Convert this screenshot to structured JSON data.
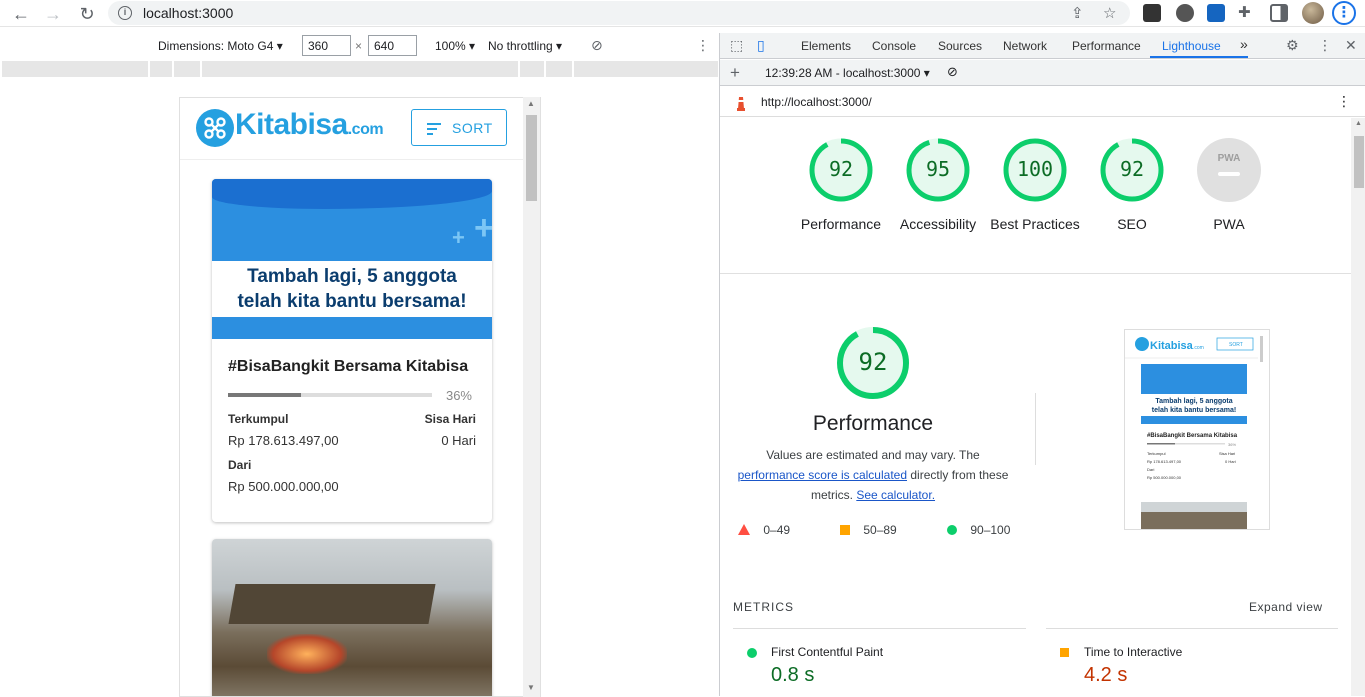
{
  "browser": {
    "url": "localhost:3000"
  },
  "device_toolbar": {
    "dimensions_label": "Dimensions: Moto G4",
    "width": "360",
    "height": "640",
    "times": "×",
    "zoom": "100%",
    "throttling": "No throttling"
  },
  "app": {
    "brand": "Kitabisa",
    "brand_suffix": ".com",
    "sort_label": "SORT",
    "card": {
      "banner_line1": "Tambah lagi, 5 anggota",
      "banner_line2": "telah kita bantu bersama!",
      "title": "#BisaBangkit Bersama Kitabisa",
      "progress_percent": 36,
      "progress_label": "36%",
      "collected_label": "Terkumpul",
      "collected_value": "Rp 178.613.497,00",
      "days_label": "Sisa Hari",
      "days_value": "0 Hari",
      "from_label": "Dari",
      "from_value": "Rp 500.000.000,00"
    }
  },
  "devtools": {
    "tabs": [
      "Elements",
      "Console",
      "Sources",
      "Network",
      "Performance",
      "Lighthouse"
    ],
    "active_tab": "Lighthouse",
    "more_tabs": "»",
    "report_selector": "12:39:28 AM - localhost:3000",
    "report_url": "http://localhost:3000/"
  },
  "lighthouse": {
    "scores": [
      {
        "label": "Performance",
        "value": "92"
      },
      {
        "label": "Accessibility",
        "value": "95"
      },
      {
        "label": "Best Practices",
        "value": "100"
      },
      {
        "label": "SEO",
        "value": "92"
      },
      {
        "label": "PWA",
        "value": "PWA"
      }
    ],
    "performance_score": "92",
    "performance_title": "Performance",
    "desc_pre": "Values are estimated and may vary. The",
    "desc_link1": "performance score is calculated",
    "desc_mid": "directly from these metrics.",
    "desc_link2": "See calculator.",
    "legend": {
      "fail": "0–49",
      "average": "50–89",
      "pass": "90–100"
    },
    "colors": {
      "pass": "#0cce6b",
      "average": "#ffa400",
      "fail": "#ff4e42",
      "pass_text": "#0c6c25",
      "average_text": "#c33300"
    },
    "metrics_heading": "METRICS",
    "expand_view": "Expand view",
    "metrics": [
      {
        "name": "First Contentful Paint",
        "value": "0.8 s",
        "status": "pass"
      },
      {
        "name": "Time to Interactive",
        "value": "4.2 s",
        "status": "average"
      }
    ]
  }
}
